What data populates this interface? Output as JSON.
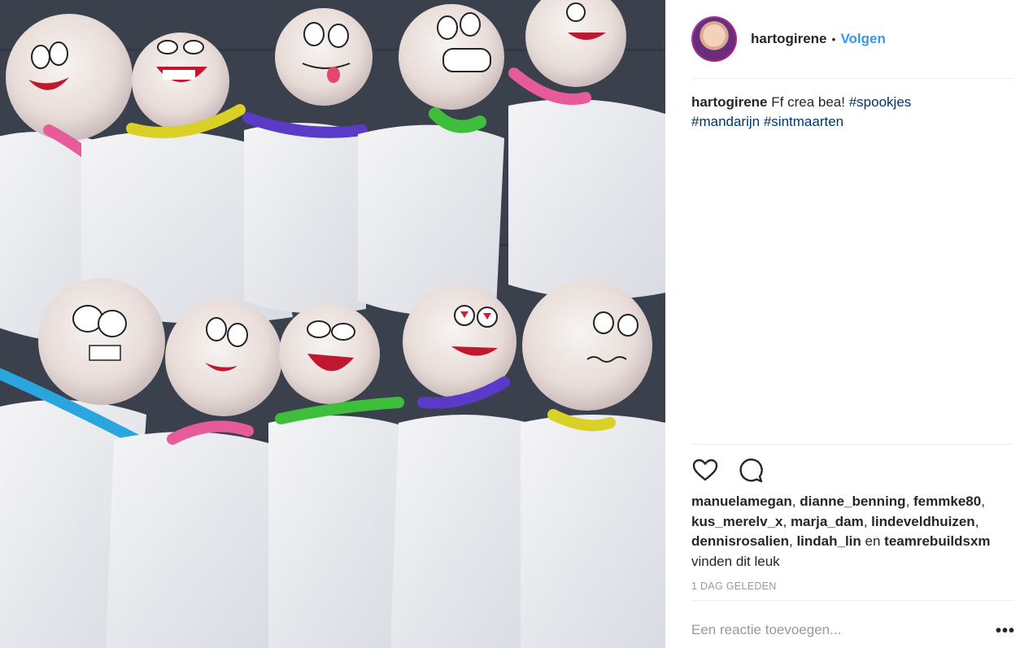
{
  "post": {
    "image_alt": "Photo of tissue-paper ghost lollipops with drawn faces and colored pipe-cleaner bows",
    "author": {
      "username": "hartogirene",
      "separator": "•",
      "follow_label": "Volgen"
    },
    "caption": {
      "username": "hartogirene",
      "text": "Ff crea bea!",
      "hashtags": [
        "#spookjes",
        "#mandarijn",
        "#sintmaarten"
      ]
    },
    "likes": {
      "users": [
        "manuelamegan",
        "dianne_benning",
        "femmke80",
        "kus_merelv_x",
        "marja_dam",
        "lindeveldhuizen",
        "dennisrosalien",
        "lindah_lin",
        "teamrebuildsxm"
      ],
      "joiner": "en",
      "suffix": "vinden dit leuk"
    },
    "timestamp": "1 DAG GELEDEN",
    "comment": {
      "placeholder": "Een reactie toevoegen...",
      "more_label": "•••"
    }
  },
  "icons": [
    "heart-icon",
    "comment-icon",
    "more-options-icon"
  ],
  "colors": {
    "link_blue": "#3897f0",
    "hashtag_blue": "#003569",
    "muted_grey": "#999999",
    "divider": "#efefef",
    "photo_background": "#3a3f4c"
  }
}
